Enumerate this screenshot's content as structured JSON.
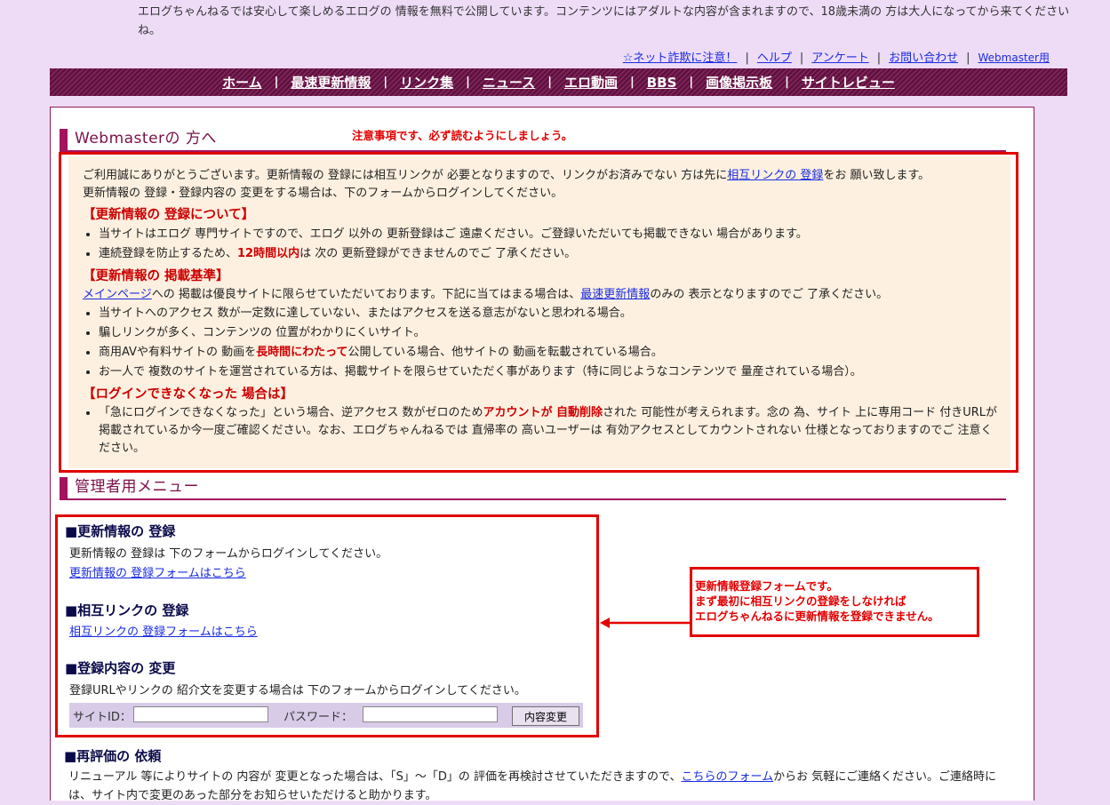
{
  "top_notice": "エログちゃんねるでは安心して楽しめるエログの 情報を無料で公開しています。コンテンツにはアダルトな内容が含まれますので、18歳未満の 方は大人になってから来てくださいね。",
  "util_links": [
    "☆ネット詐欺に注意！",
    "ヘルプ",
    "アンケート",
    "お問い合わせ",
    "Webmaster用"
  ],
  "nav": [
    "ホーム",
    "最速更新情報",
    "リンク集",
    "ニュース",
    "エロ動画",
    "BBS",
    "画像掲示板",
    "サイトレビュー"
  ],
  "webmaster_section": {
    "title": "Webmasterの 方へ",
    "annotation": "注意事項です、必ず読むようにしましょう。"
  },
  "info": {
    "intro_pre": "ご利用誠にありがとうございます。更新情報の 登録には相互リンクが 必要となりますので、リンクがお済みでない 方は先に",
    "intro_link": "相互リンクの 登録",
    "intro_post": "をお 願い致します。",
    "intro2": "更新情報の 登録・登録内容の 変更をする場合は、下のフォームからログインしてください。",
    "sec1_title": "【更新情報の 登録について】",
    "sec1_b1": "当サイトはエログ 専門サイトですので、エログ 以外の 更新登録はご 遠慮ください。ご登録いただいても掲載できない 場合があります。",
    "sec1_b2_pre": "連続登録を防止するため、",
    "sec1_b2_emph": "12時間以内",
    "sec1_b2_post": "は 次の 更新登録ができませんのでご 了承ください。",
    "sec2_title": "【更新情報の 掲載基準】",
    "sec2_link1": "メインページ",
    "sec2_mid": "への 掲載は優良サイトに限らせていただいております。下記に当てはまる場合は、",
    "sec2_link2": "最速更新情報",
    "sec2_post": "のみの 表示となりますのでご 了承ください。",
    "sec2_b1": "当サイトへのアクセス 数が一定数に達していない、またはアクセスを送る意志がないと思われる場合。",
    "sec2_b2": "騙しリンクが多く、コンテンツの 位置がわかりにくいサイト。",
    "sec2_b3_pre": "商用AVや有料サイトの 動画を",
    "sec2_b3_emph": "長時間にわたって",
    "sec2_b3_post": "公開している場合、他サイトの 動画を転載されている場合。",
    "sec2_b4": "お一人で 複数のサイトを運営されている方は、掲載サイトを限らせていただく事があります（特に同じようなコンテンツで 量産されている場合）。",
    "sec3_title": "【ログインできなくなった 場合は】",
    "sec3_b1_pre": "「急にログインできなくなった」という場合、逆アクセス 数がゼロのため",
    "sec3_b1_emph": "アカウントが 自動削除",
    "sec3_b1_post": "された 可能性が考えられます。念の 為、サイト 上に専用コード 付きURLが 掲載されているか今一度ご確認ください。なお、エログちゃんねるでは 直帰率の 高いユーザーは 有効アクセスとしてカウントされない 仕様となっておりますのでご 注意ください。"
  },
  "admin_section": {
    "title": "管理者用メニュー",
    "reg_title": "■更新情報の 登録",
    "reg_text": "更新情報の 登録は 下のフォームからログインしてください。",
    "reg_link": "更新情報の 登録フォームはこちら",
    "mutual_title": "■相互リンクの 登録",
    "mutual_link": "相互リンクの 登録フォームはこちら",
    "change_title": "■登録内容の 変更",
    "change_text": "登録URLやリンクの 紹介文を変更する場合は 下のフォームからログインしてください。",
    "site_id_label": "サイトID：",
    "password_label": "パスワード：",
    "submit_label": "内容変更"
  },
  "callout": [
    "更新情報登録フォームです。",
    "まず最初に相互リンクの登録をしなければ",
    "エログちゃんねるに更新情報を登録できません。"
  ],
  "reeval": {
    "title": "■再評価の 依頼",
    "text_pre": "リニューアル 等によりサイトの 内容が 変更となった場合は、「S」〜「D」の 評価を再検討させていただきますので、",
    "link": "こちらのフォーム",
    "text_post": "からお 気軽にご連絡ください。ご連絡時には、サイト内で変更のあった部分をお知らせいただけると助かります。"
  }
}
